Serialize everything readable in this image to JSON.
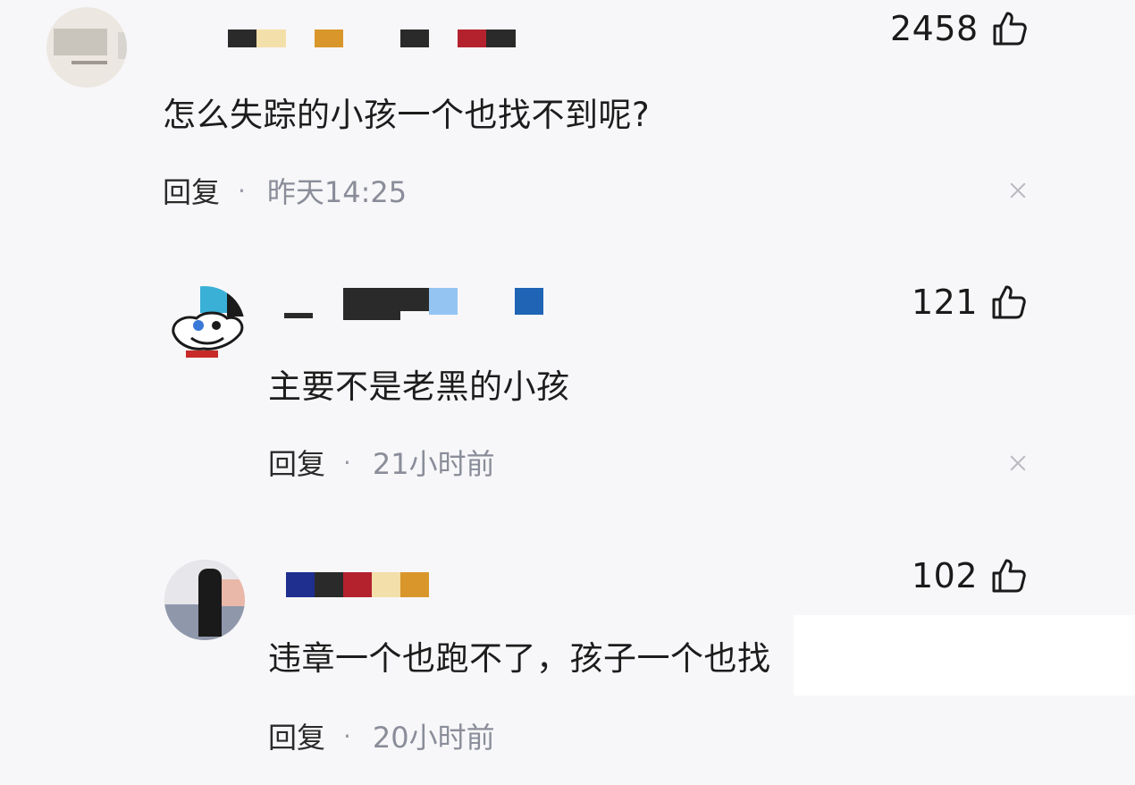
{
  "comments": [
    {
      "likes": "2458",
      "text": "怎么失踪的小孩一个也找不到呢?",
      "reply_label": "回复",
      "separator": "·",
      "time": "昨天14:25",
      "name_colors": [
        "#2a2a2a",
        "#f3dfa9",
        "#d9962a",
        "#2a2a2a",
        "#b4222e",
        "#2a2a2a"
      ]
    },
    {
      "likes": "121",
      "text": "主要不是老黑的小孩",
      "reply_label": "回复",
      "separator": "·",
      "time": "21小时前",
      "name_colors": [
        "#2a2a2a",
        "#2a2a2a",
        "#94c4f1",
        "#1f64b5"
      ]
    },
    {
      "likes": "102",
      "text": "违章一个也跑不了，孩子一个也找",
      "reply_label": "回复",
      "separator": "·",
      "time": "20小时前",
      "name_colors": [
        "#1f2f8f",
        "#2a2a2a",
        "#b4222e",
        "#f3dfa9",
        "#d9962a"
      ]
    }
  ],
  "icons": {
    "like": "thumbs-up-icon",
    "dismiss": "close-icon"
  }
}
